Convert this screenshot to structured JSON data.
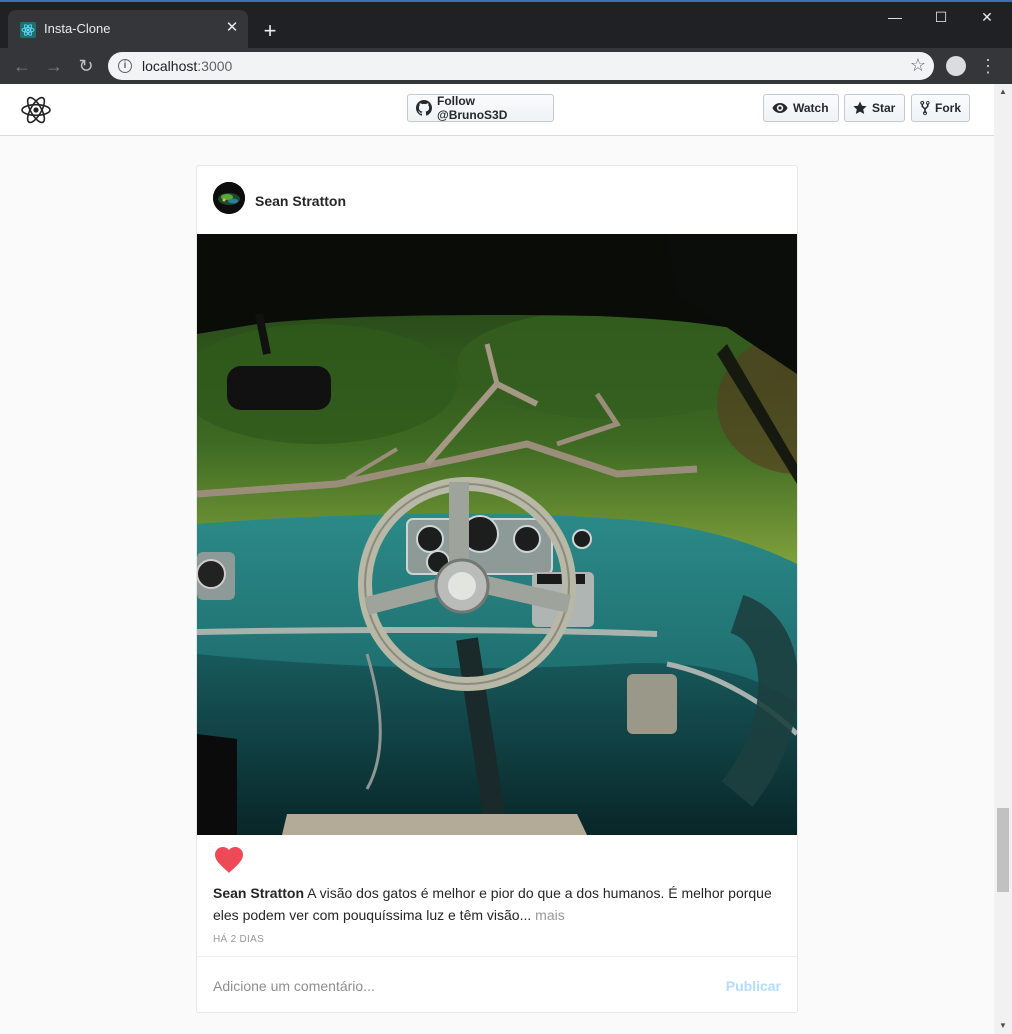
{
  "browser": {
    "tab_title": "Insta-Clone",
    "url_host": "localhost",
    "url_port": ":3000"
  },
  "header": {
    "follow_label": "Follow @BrunoS3D",
    "watch_label": "Watch",
    "star_label": "Star",
    "fork_label": "Fork"
  },
  "post": {
    "author": "Sean Stratton",
    "caption_user": "Sean Stratton",
    "caption_text": " A visão dos gatos é melhor e pior do que a dos humanos. É melhor porque eles podem ver com pouquíssima luz e têm visão...",
    "more_label": "mais",
    "timestamp": "HÁ 2 DIAS",
    "liked": true,
    "comment_placeholder": "Adicione um comentário...",
    "publish_label": "Publicar"
  },
  "colors": {
    "heart": "#ed4956",
    "publish_disabled": "#b3dbff",
    "react_logo": "#222222"
  },
  "icons": [
    "react-logo-icon",
    "github-icon",
    "eye-icon",
    "star-icon",
    "fork-icon",
    "heart-icon",
    "info-icon",
    "bookmark-star-icon",
    "kebab-menu-icon"
  ]
}
